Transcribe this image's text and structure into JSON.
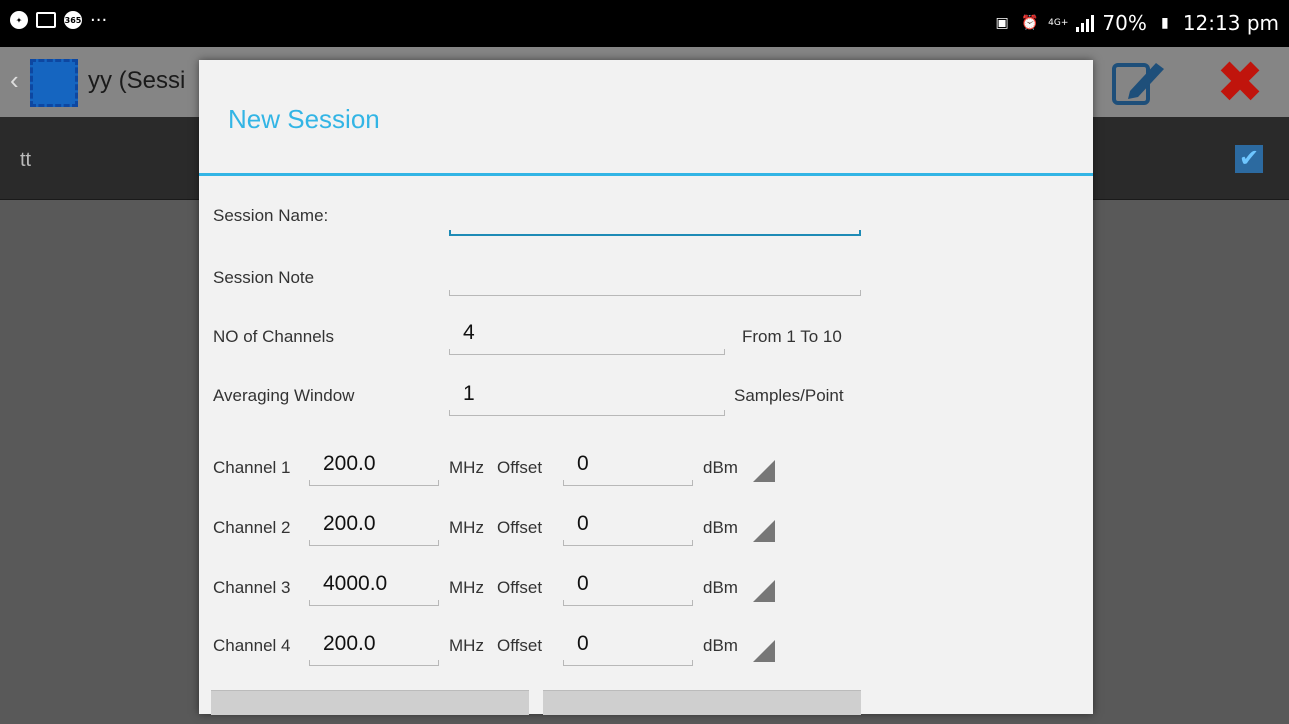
{
  "status_bar": {
    "left_icons": [
      "messenger-icon",
      "gallery-icon",
      "office365-icon",
      "more-dots-icon"
    ],
    "more_dots": "···",
    "network": "4G+",
    "battery": "70%",
    "time": "12:13 pm"
  },
  "action_bar": {
    "back_glyph": "‹",
    "title": "yy (Sessi",
    "edit_icon": "edit-icon",
    "close_icon": "close-icon",
    "close_glyph": "✖"
  },
  "background_list": {
    "row_text": "tt",
    "checked": true
  },
  "dialog": {
    "title": "New Session",
    "accent_color": "#33b5e5",
    "session_name": {
      "label": "Session Name:",
      "value": ""
    },
    "session_note": {
      "label": "Session Note",
      "value": ""
    },
    "channels": {
      "label": "NO of Channels",
      "value": "4",
      "hint": "From 1 To 10"
    },
    "averaging": {
      "label": "Averaging Window",
      "value": "1",
      "hint": "Samples/Point"
    },
    "channel_rows": [
      {
        "label": "Channel 1",
        "freq": "200.0",
        "freq_unit": "MHz",
        "offset_label": "Offset",
        "offset": "0",
        "offset_unit": "dBm"
      },
      {
        "label": "Channel 2",
        "freq": "200.0",
        "freq_unit": "MHz",
        "offset_label": "Offset",
        "offset": "0",
        "offset_unit": "dBm"
      },
      {
        "label": "Channel 3",
        "freq": "4000.0",
        "freq_unit": "MHz",
        "offset_label": "Offset",
        "offset": "0",
        "offset_unit": "dBm"
      },
      {
        "label": "Channel 4",
        "freq": "200.0",
        "freq_unit": "MHz",
        "offset_label": "Offset",
        "offset": "0",
        "offset_unit": "dBm"
      }
    ]
  }
}
